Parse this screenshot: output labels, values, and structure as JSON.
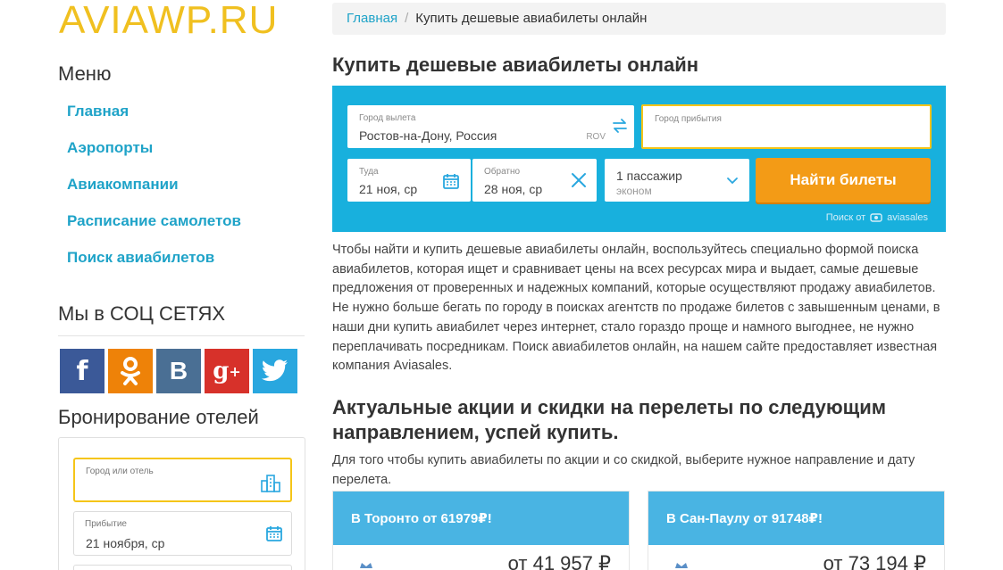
{
  "site": {
    "logo": "AVIAWP.RU"
  },
  "sidebar": {
    "menu_title": "Меню",
    "menu": [
      "Главная",
      "Аэропорты",
      "Авиакомпании",
      "Расписание самолетов",
      "Поиск авиабилетов"
    ],
    "social_title": "Мы в СОЦ СЕТЯХ",
    "social": [
      {
        "name": "facebook",
        "glyph": "f",
        "color": "#3b5998"
      },
      {
        "name": "odnoklassniki",
        "glyph": "ok",
        "color": "#ee8208"
      },
      {
        "name": "vkontakte",
        "glyph": "B",
        "color": "#4a6f94"
      },
      {
        "name": "google-plus",
        "glyph": "g+",
        "color": "#d7312a"
      },
      {
        "name": "twitter",
        "glyph": "bird",
        "color": "#29a7df"
      }
    ],
    "hotels_title": "Бронирование отелей",
    "hotel_form": {
      "city_label": "Город или отель",
      "city_value": "",
      "arrival_label": "Прибытие",
      "arrival_value": "21 ноября, ср"
    }
  },
  "breadcrumb": {
    "home": "Главная",
    "separator": "/",
    "current": "Купить дешевые авиабилеты онлайн"
  },
  "page_title": "Купить дешевые авиабилеты онлайн",
  "search_form": {
    "from_label": "Город вылета",
    "from_value": "Ростов-на-Дону, Россия",
    "from_code": "ROV",
    "to_label": "Город прибытия",
    "to_value": "",
    "depart_label": "Туда",
    "depart_value": "21 ноя, ср",
    "return_label": "Обратно",
    "return_value": "28 ноя, ср",
    "passengers": "1 пассажир",
    "cabin_class": "эконом",
    "submit_label": "Найти билеты",
    "powered_by": "Поиск от",
    "powered_brand": "aviasales",
    "accent_color": "#18b0dd",
    "button_color": "#f39b16"
  },
  "intro_text": "Чтобы найти и купить дешевые авиабилеты онлайн, воспользуйтесь специально формой поиска авиабилетов, которая ищет и сравнивает цены на всех ресурсах мира и выдает, самые дешевые предложения от проверенных и надежных компаний, которые осуществляют продажу авиабилетов. Не нужно больше бегать по городу в поисках агентств по продаже билетов с завышенным ценами, в наши дни купить авиабилет через интернет, стало гораздо проще и намного выгоднее, не нужно переплачивать посредникам. Поиск авиабилетов онлайн, на нашем сайте предоставляет известная компания Aviasales.",
  "deals_title": "Актуальные акции и скидки на перелеты по следующим направлением, успей купить.",
  "deals_intro": "Для того чтобы купить авиабилеты по акции и со скидкой, выберите нужное направление и дату перелета.",
  "deals": [
    {
      "title": "В Торонто от 61979₽!",
      "price": "от 41 957 ₽"
    },
    {
      "title": "В Сан-Паулу от 91748₽!",
      "price": "от 73 194 ₽"
    }
  ]
}
